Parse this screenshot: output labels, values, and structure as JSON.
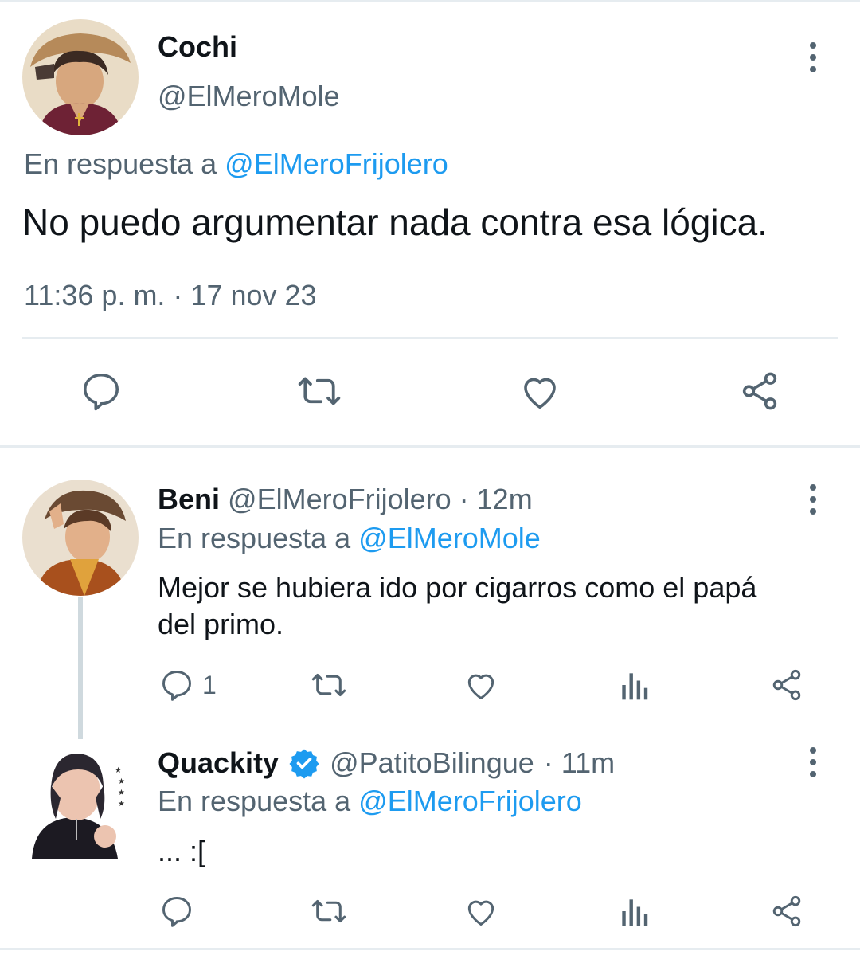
{
  "main_tweet": {
    "name": "Cochi",
    "handle": "@ElMeroMole",
    "reply_prefix": "En respuesta a",
    "reply_to": "@ElMeroFrijolero",
    "text": "No puedo argumentar nada contra esa lógica.",
    "timestamp": "11:36 p. m. · 17 nov 23"
  },
  "replies": [
    {
      "name": "Beni",
      "handle": "@ElMeroFrijolero",
      "time": "· 12m",
      "reply_prefix": "En respuesta a",
      "reply_to": "@ElMeroMole",
      "text_line1": "Mejor se hubiera ido por cigarros como el papá",
      "text_line2": "del primo.",
      "reply_count": "1"
    },
    {
      "name": "Quackity",
      "handle": "@PatitoBilingue",
      "time": "· 11m",
      "reply_prefix": "En respuesta a",
      "reply_to": "@ElMeroFrijolero",
      "text": "... :["
    }
  ],
  "icons": {
    "reply": "reply-icon",
    "retweet": "retweet-icon",
    "like": "heart-icon",
    "views": "views-icon",
    "share": "share-icon",
    "more": "more-icon",
    "verified": "verified-badge-icon"
  },
  "colors": {
    "link": "#1d9bf0",
    "muted": "#536471",
    "text": "#0f1419",
    "divider": "#e6ecf0",
    "verified": "#1d9bf0"
  }
}
